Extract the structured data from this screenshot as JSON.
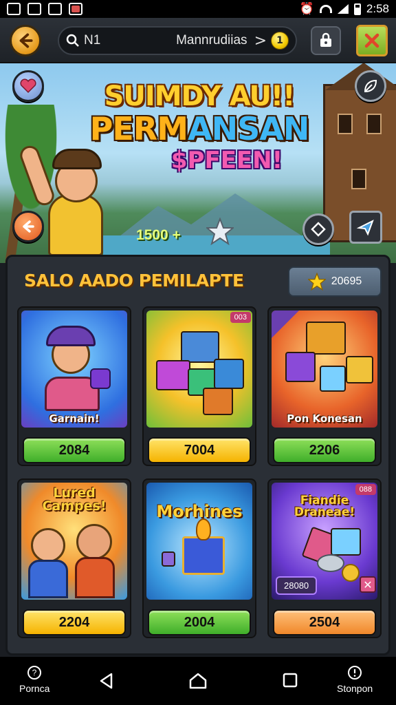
{
  "status_bar": {
    "time": "2:58"
  },
  "top_bar": {
    "search_query": "N1",
    "title": "Mannrudiias",
    "chevron": ">",
    "coin_value": "1"
  },
  "banner": {
    "title_line1": "SUIMDY AU!!",
    "title_line2_a": "PERM",
    "title_line2_b": "ANSAN",
    "title_line3": "$PFEEN!",
    "score": "1500 +"
  },
  "shop": {
    "title": "SALO AADO PEMILAPTE",
    "balance": "20695",
    "items": [
      {
        "caption": "Garnain!",
        "head": "",
        "tag": "",
        "price": "2084",
        "color": "green"
      },
      {
        "caption": "",
        "head": "",
        "tag": "003",
        "price": "7004",
        "color": "yellow"
      },
      {
        "caption": "Pon Konesan",
        "head": "",
        "tag": "",
        "price": "2206",
        "color": "green"
      },
      {
        "caption": "",
        "head": "Lured Campes!",
        "tag": "",
        "price": "2204",
        "color": "yellow"
      },
      {
        "caption": "",
        "head": "Morhines",
        "tag": "",
        "price": "2004",
        "color": "green"
      },
      {
        "caption": "",
        "head": "Fiandie Draneae!",
        "tag": "088",
        "badge": "28080",
        "price": "2504",
        "color": "orange"
      }
    ]
  },
  "nav": {
    "left_label": "Pornca",
    "right_label": "Stonpon"
  },
  "colors": {
    "accent": "#ffc23a",
    "panel": "#2a2f36"
  }
}
